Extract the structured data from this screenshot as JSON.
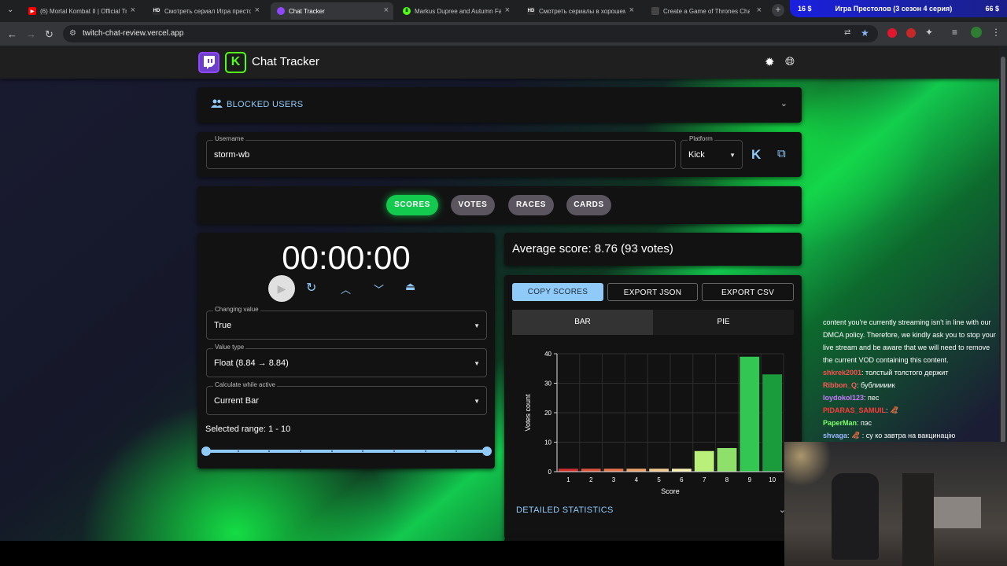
{
  "browser": {
    "tabs": [
      {
        "title": "(6) Mortal Kombat II | Official Tr",
        "fav": "▶",
        "fav_color": "#ff0000"
      },
      {
        "title": "Смотреть сериал Игра престо",
        "fav": "HD",
        "fav_color": "#2b2b2b"
      },
      {
        "title": "Chat Tracker",
        "fav": "",
        "fav_color": "#9146ff"
      },
      {
        "title": "Markus Dupree and Autumn Fa",
        "fav": "8",
        "fav_color": "#53fc18"
      },
      {
        "title": "Смотреть сериалы в хорошем",
        "fav": "HD",
        "fav_color": "#2b2b2b"
      },
      {
        "title": "Create a Game of Thrones Cha",
        "fav": "",
        "fav_color": "#444444"
      }
    ],
    "promo": {
      "left": "16 $",
      "middle": "Игра Престолов (3 сезон 4 серия)",
      "right": "66 $"
    },
    "url": "twitch-chat-review.vercel.app"
  },
  "app": {
    "title": "Chat Tracker",
    "kick_logo_letter": "K",
    "theme_icon": "brightness-icon",
    "language_icon": "globe-icon"
  },
  "blocked": {
    "label": "BLOCKED USERS"
  },
  "form": {
    "username_label": "Username",
    "username_value": "storm-wb",
    "platform_label": "Platform",
    "platform_value": "Kick",
    "kick_button_letter": "K"
  },
  "tabs": [
    "SCORES",
    "VOTES",
    "RACES",
    "CARDS"
  ],
  "timer": {
    "display": "00:00:00",
    "changing_label": "Changing value",
    "changing_value": "True",
    "valuetype_label": "Value type",
    "valuetype_value": "Float (8.84 → 8.84)",
    "calc_label": "Calculate while active",
    "calc_value": "Current Bar",
    "range_label": "Selected range: 1 - 10",
    "range": [
      1,
      10
    ]
  },
  "average": {
    "text": "Average score: 8.76 (93 votes)"
  },
  "actions": {
    "copy": "COPY SCORES",
    "json": "EXPORT JSON",
    "csv": "EXPORT CSV"
  },
  "chart_toggle": {
    "bar": "BAR",
    "pie": "PIE"
  },
  "detailed": {
    "label": "DETAILED STATISTICS"
  },
  "chart_data": {
    "type": "bar",
    "categories": [
      "1",
      "2",
      "3",
      "4",
      "5",
      "6",
      "7",
      "8",
      "9",
      "10"
    ],
    "values": [
      1,
      1,
      1,
      1,
      1,
      1,
      7,
      8,
      39,
      33
    ],
    "colors": [
      "#d32f2f",
      "#e0533a",
      "#e8724a",
      "#eda36a",
      "#f2c98e",
      "#f7f0b0",
      "#b8f07a",
      "#8ee06a",
      "#34c653",
      "#1a9c3c"
    ],
    "xlabel": "Score",
    "ylabel": "Votes count",
    "ylim": [
      0,
      40
    ],
    "yticks": [
      0,
      10,
      20,
      30,
      40
    ],
    "grid": true
  },
  "chat": [
    {
      "user": "",
      "color": "#ffffff",
      "text": "content you're currently streaming isn't in line with our"
    },
    {
      "user": "",
      "color": "#ffffff",
      "text": "DMCA policy. Therefore, we kindly ask you to stop your"
    },
    {
      "user": "",
      "color": "#ffffff",
      "text": "live stream and be aware that we will need to remove"
    },
    {
      "user": "",
      "color": "#ffffff",
      "text": "the current VOD containing this content."
    },
    {
      "user": "shkrek2001",
      "color": "#ff4d4d",
      "text": ": толстый толстого держит"
    },
    {
      "user": "Ribbon_Q",
      "color": "#ff5a5a",
      "text": ": бублиииик"
    },
    {
      "user": "loydokol123",
      "color": "#c77dff",
      "text": ": пес"
    },
    {
      "user": "PIDARAS_SAMUIL",
      "color": "#ff3a3a",
      "text": ": 🦧"
    },
    {
      "user": "PaperMan",
      "color": "#7dff6a",
      "text": ": пэс"
    },
    {
      "user": "shvaga",
      "color": "#9ab8ff",
      "text": ": 🦧 : су ко завтра на вакцинацію"
    }
  ]
}
